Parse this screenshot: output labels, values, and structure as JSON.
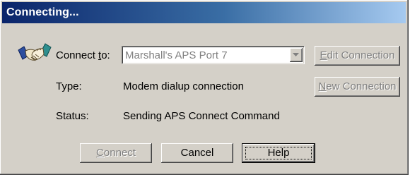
{
  "window": {
    "title": "Connecting..."
  },
  "connect_to": {
    "label_pre": "Connect ",
    "label_mnemonic": "t",
    "label_post": "o:",
    "value": "Marshall's APS Port 7"
  },
  "type": {
    "label": "Type:",
    "value": "Modem dialup connection"
  },
  "status": {
    "label": "Status:",
    "value": "Sending APS Connect Command"
  },
  "buttons": {
    "edit_connection": {
      "mnemonic": "E",
      "rest": "dit Connection"
    },
    "new_connection": {
      "mnemonic": "N",
      "rest": "ew Connection"
    },
    "connect": {
      "mnemonic": "C",
      "rest": "onnect"
    },
    "cancel": "Cancel",
    "help": "Help"
  },
  "icons": {
    "connection": "handshake-icon",
    "dropdown": "chevron-down-icon"
  }
}
